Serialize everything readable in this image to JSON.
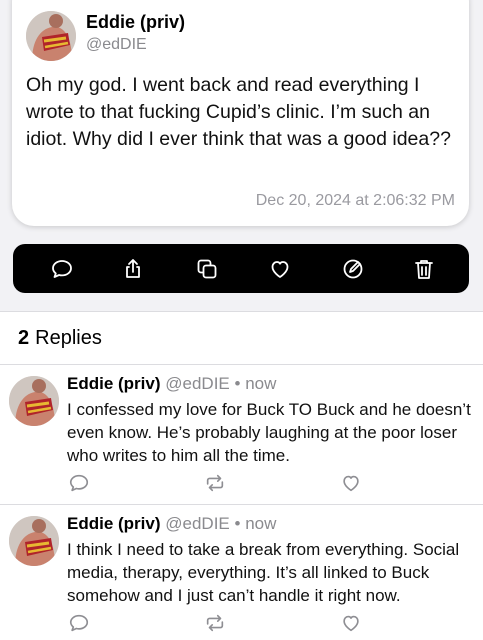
{
  "post": {
    "author_name": "Eddie (priv)",
    "author_handle": "@edDIE",
    "text": "Oh my god. I went back and read everything I wrote to that fucking Cupid’s clinic. I’m such an idiot. Why did I ever think that was a good idea??",
    "timestamp": "Dec 20, 2024 at 2:06:32 PM"
  },
  "action_bar": {
    "icons": [
      "reply-icon",
      "share-icon",
      "copy-icon",
      "like-icon",
      "edit-icon",
      "delete-icon"
    ]
  },
  "replies_header": {
    "count": "2",
    "label": "Replies"
  },
  "replies": [
    {
      "author_name": "Eddie (priv)",
      "author_handle": "@edDIE",
      "separator": "•",
      "time": "now",
      "text": "I confessed my love for Buck TO Buck and he doesn’t even know. He’s probably laughing at the poor loser who writes to him all the time."
    },
    {
      "author_name": "Eddie (priv)",
      "author_handle": "@edDIE",
      "separator": "•",
      "time": "now",
      "text": "I think I need to take a break from everything. Social media, therapy, everything. It’s all linked to Buck somehow and I just can’t handle it right now."
    }
  ],
  "colors": {
    "background_top": "#f2f2f5",
    "action_bar": "#000000",
    "secondary_text": "#8a8a8e",
    "icon_gray": "#8e8e93"
  }
}
